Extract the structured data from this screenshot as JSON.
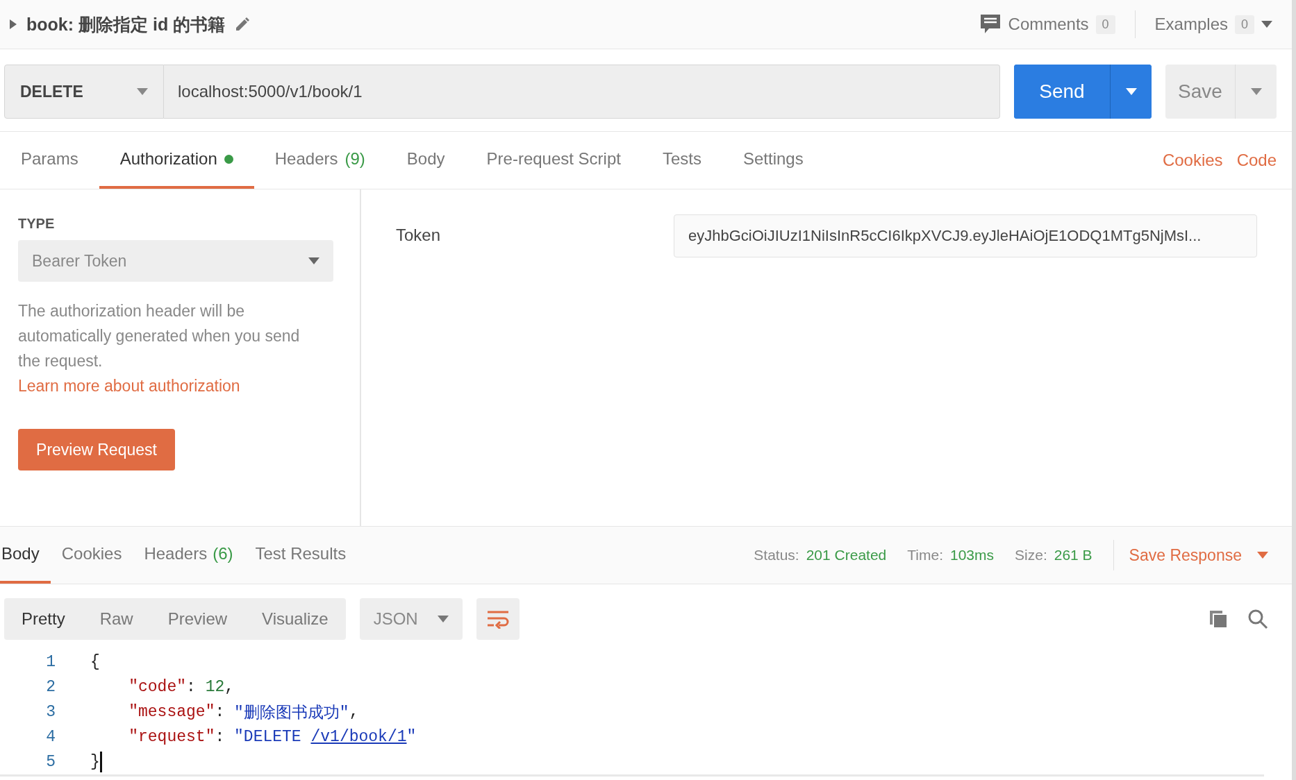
{
  "header": {
    "title": "book: 删除指定 id 的书籍",
    "comments": {
      "label": "Comments",
      "count": "0"
    },
    "examples": {
      "label": "Examples",
      "count": "0"
    }
  },
  "request": {
    "method": "DELETE",
    "url": "localhost:5000/v1/book/1",
    "send": "Send",
    "save": "Save"
  },
  "tabs": [
    {
      "label": "Params",
      "selected": false
    },
    {
      "label": "Authorization",
      "selected": true,
      "dot": true
    },
    {
      "label": "Headers",
      "count": "(9)",
      "selected": false
    },
    {
      "label": "Body",
      "selected": false
    },
    {
      "label": "Pre-request Script",
      "selected": false
    },
    {
      "label": "Tests",
      "selected": false
    },
    {
      "label": "Settings",
      "selected": false
    }
  ],
  "tab_links": [
    "Cookies",
    "Code"
  ],
  "auth": {
    "type_label": "TYPE",
    "type_value": "Bearer Token",
    "help_text": "The authorization header will be automatically generated when you send the request. ",
    "help_link": "Learn more about authorization",
    "preview_button": "Preview Request",
    "token_label": "Token",
    "token_value": "eyJhbGciOiJIUzI1NiIsInR5cCI6IkpXVCJ9.eyJleHAiOjE1ODQ1MTg5NjMsI..."
  },
  "response_tabs": [
    {
      "label": "Body",
      "selected": true
    },
    {
      "label": "Cookies",
      "selected": false
    },
    {
      "label": "Headers",
      "count": "(6)",
      "selected": false
    },
    {
      "label": "Test Results",
      "selected": false
    }
  ],
  "response_meta": [
    {
      "label": "Status:",
      "value": "201 Created"
    },
    {
      "label": "Time:",
      "value": "103ms"
    },
    {
      "label": "Size:",
      "value": "261 B"
    }
  ],
  "save_response": "Save Response",
  "view_modes": [
    {
      "label": "Pretty",
      "selected": true
    },
    {
      "label": "Raw",
      "selected": false
    },
    {
      "label": "Preview",
      "selected": false
    },
    {
      "label": "Visualize",
      "selected": false
    }
  ],
  "format": "JSON",
  "code_lines": [
    {
      "number": "1",
      "active": false,
      "segments": [
        {
          "kind": "punct",
          "text": "{"
        }
      ]
    },
    {
      "number": "2",
      "active": false,
      "segments": [
        {
          "kind": "key",
          "text": "    \"code\""
        },
        {
          "kind": "punct",
          "text": ": "
        },
        {
          "kind": "number",
          "text": "12"
        },
        {
          "kind": "punct",
          "text": ","
        }
      ]
    },
    {
      "number": "3",
      "active": false,
      "segments": [
        {
          "kind": "key",
          "text": "    \"message\""
        },
        {
          "kind": "punct",
          "text": ": "
        },
        {
          "kind": "string",
          "text": "\"删除图书成功\""
        },
        {
          "kind": "punct",
          "text": ","
        }
      ]
    },
    {
      "number": "4",
      "active": false,
      "segments": [
        {
          "kind": "key",
          "text": "    \"request\""
        },
        {
          "kind": "punct",
          "text": ": "
        },
        {
          "kind": "string",
          "text": "\"DELETE "
        },
        {
          "kind": "link",
          "text": "/v1/book/1"
        },
        {
          "kind": "string",
          "text": "\""
        }
      ]
    },
    {
      "number": "5",
      "active": true,
      "segments": [
        {
          "kind": "punct",
          "text": "}"
        }
      ]
    }
  ]
}
